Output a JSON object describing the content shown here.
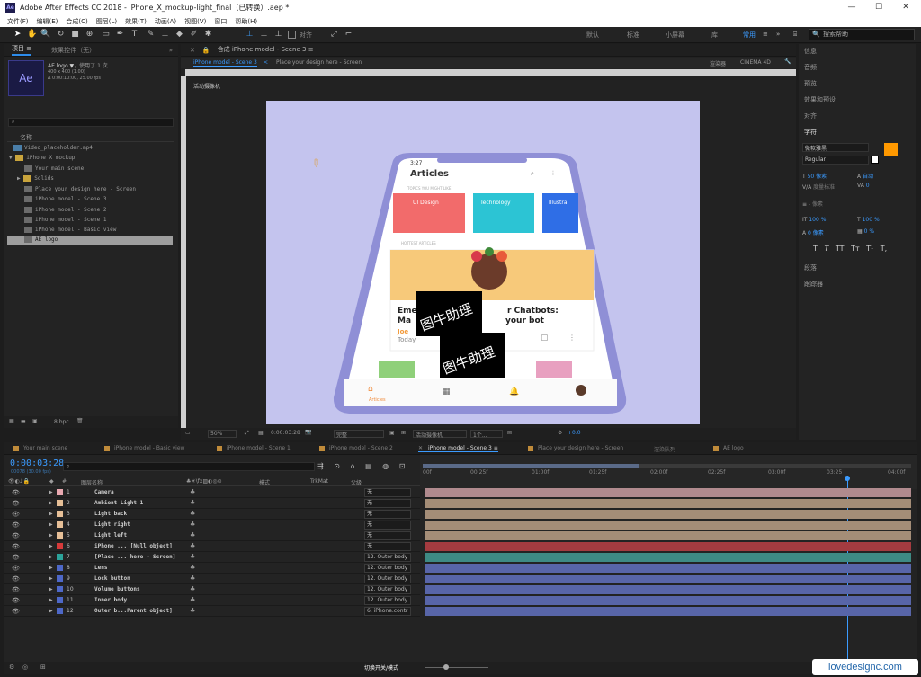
{
  "window": {
    "title": "Adobe After Effects CC 2018 - iPhone_X_mockup-light_final（已转换）.aep *",
    "app_icon": "Ae"
  },
  "menu": [
    "文件(F)",
    "编辑(E)",
    "合成(C)",
    "图层(L)",
    "效果(T)",
    "动画(A)",
    "视图(V)",
    "窗口",
    "帮助(H)"
  ],
  "toolbar": {
    "snap_label": "对齐",
    "workspaces": [
      "默认",
      "标准",
      "小屏幕",
      "库",
      "常用"
    ],
    "search_placeholder": "搜索帮助"
  },
  "project": {
    "tab_project": "项目 ≡",
    "tab_effects": "效果控件（无）",
    "item_name": "AE logo ▼",
    "item_used": "，使用了 1 次",
    "item_size": "400 x 400 (1.00)",
    "item_duration": "Δ 0:00:10:00, 25.00 fps",
    "thumb_label": "Ae",
    "column_name": "名称",
    "rows": [
      "Video_placeholder.mp4",
      "iPhone X mockup",
      "Your main scene",
      "Solids",
      "Place your design here - Screen",
      "iPhone model - Scene 3",
      "iPhone model - Scene 2",
      "iPhone model - Scene 1",
      "iPhone model - Basic view",
      "AE logo"
    ],
    "bpc": "8 bpc"
  },
  "composition": {
    "tab": "合成 iPhone model - Scene 3 ≡",
    "sub_tab_active": "iPhone model - Scene 3",
    "sub_tab_other": "Place your design here - Screen",
    "renderer_label": "渲染器",
    "renderer_value": "CINEMA 4D",
    "camera_label": "活动摄像机",
    "zoom": "50%",
    "timecode": "0:00:03:28",
    "quality": "完整",
    "view": "活动摄像机",
    "views_count": "1个...",
    "exposure": "+0.0"
  },
  "phone": {
    "status_time": "3:27",
    "header": "Articles",
    "section1": "TOPICS YOU MIGHT LIKE",
    "cards": [
      {
        "label": "UI Design",
        "color": "#f26b6b"
      },
      {
        "label": "Technology",
        "color": "#2cc4d4"
      },
      {
        "label": "Illustra",
        "color": "#2f6ee6"
      }
    ],
    "section2": "HOTTEST ARTICLES",
    "article_title_left": "Eme",
    "article_title_left2": "Ma",
    "article_title_right": "r Chatbots:",
    "article_title_right2": "your bot",
    "author": "Joe",
    "date": "Today",
    "nav_label": "Articles",
    "watermark1": "图牛助理",
    "watermark2": "图牛助理",
    "bg_color": "#c4c4ee"
  },
  "right_panel": {
    "items": [
      "信息",
      "音频",
      "预览",
      "效果和预设",
      "对齐"
    ],
    "char_title": "字符",
    "font_name": "微软雅黑",
    "font_style": "Regular",
    "font_size": "50 像素",
    "leading": "自动",
    "tracking_label": "度量标准",
    "tracking_value": "0",
    "stroke": "- 像素",
    "vscale": "100 %",
    "hscale": "100 %",
    "baseline": "0 像素",
    "tsume": "0 %",
    "style_buttons": [
      "T",
      "T",
      "TT",
      "Tт",
      "T¹",
      "T,"
    ],
    "para": "段落",
    "tracker": "跟踪器",
    "fill_color": "#ff9900"
  },
  "timeline": {
    "tabs": [
      "Your main scene",
      "iPhone model - Basic view",
      "iPhone model - Scene 1",
      "iPhone model - Scene 2",
      "iPhone model - Scene 3",
      "Place your design here - Screen",
      "渲染队列",
      "AE logo"
    ],
    "active_tab": "iPhone model - Scene 3 ≡",
    "timecode": "0:00:03:28",
    "frame_info": "00078 (30.00 fps)",
    "headers": {
      "layer_name": "图层名称",
      "mode": "模式",
      "trkmat": "TrkMat",
      "parent": "父级"
    },
    "ruler": [
      "00f",
      "00:25f",
      "01:00f",
      "01:25f",
      "02:00f",
      "02:25f",
      "03:00f",
      "03:25",
      "04:00f"
    ],
    "layers": [
      {
        "num": "1",
        "name": "Camera",
        "label_color": "#e9a9b1",
        "parent": "无",
        "bar": "#b08a8e"
      },
      {
        "num": "2",
        "name": "Ambient Light 1",
        "label_color": "#e6bf97",
        "parent": "无",
        "bar": "#a48d77"
      },
      {
        "num": "3",
        "name": "Light back",
        "label_color": "#e6bf97",
        "parent": "无",
        "bar": "#a48d77"
      },
      {
        "num": "4",
        "name": "Light right",
        "label_color": "#e6bf97",
        "parent": "无",
        "bar": "#a48d77"
      },
      {
        "num": "5",
        "name": "Light left",
        "label_color": "#e6bf97",
        "parent": "无",
        "bar": "#a48d77"
      },
      {
        "num": "6",
        "name": "iPhone ... [Null object]",
        "label_color": "#d63a3a",
        "parent": "无",
        "bar": "#a43b40"
      },
      {
        "num": "7",
        "name": "[Place ... here - Screen]",
        "label_color": "#2ca39a",
        "parent": "12. Outer body",
        "bar": "#3e8a84"
      },
      {
        "num": "8",
        "name": "Lens",
        "label_color": "#4e68c8",
        "parent": "12. Outer body",
        "bar": "#5865a8"
      },
      {
        "num": "9",
        "name": "Lock button",
        "label_color": "#4e68c8",
        "parent": "12. Outer body",
        "bar": "#5865a8"
      },
      {
        "num": "10",
        "name": "Volume buttons",
        "label_color": "#4e68c8",
        "parent": "12. Outer body",
        "bar": "#5865a8"
      },
      {
        "num": "11",
        "name": "Inner body",
        "label_color": "#4e68c8",
        "parent": "12. Outer body",
        "bar": "#5865a8"
      },
      {
        "num": "12",
        "name": "Outer b...Parent object]",
        "label_color": "#4e68c8",
        "parent": "6. iPhone.contr",
        "bar": "#5865a8"
      }
    ],
    "footer_label": "切换开关/模式"
  },
  "site_watermark": "lovedesignc.com"
}
